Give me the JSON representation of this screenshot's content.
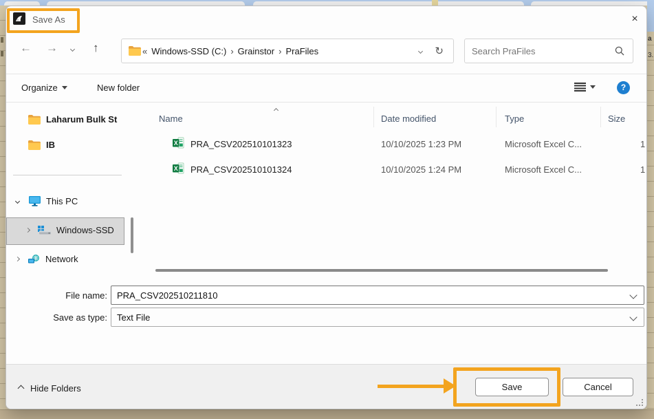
{
  "window": {
    "title": "Save As"
  },
  "glyphs": {
    "back": "←",
    "forward": "→",
    "up": "↑",
    "refresh": "↻",
    "close": "×",
    "help": "?"
  },
  "nav": {
    "breadcrumb_overflow": "«",
    "breadcrumb_separator": "›",
    "crumbs": [
      "Windows-SSD (C:)",
      "Grainstor",
      "PraFiles"
    ],
    "search_placeholder": "Search PraFiles"
  },
  "toolbar": {
    "organize_label": "Organize",
    "new_folder_label": "New folder"
  },
  "sidebar": {
    "items": [
      {
        "label": "Laharum Bulk St"
      },
      {
        "label": "IB"
      },
      {
        "label": "This PC"
      },
      {
        "label": "Windows-SSD"
      },
      {
        "label": "Network"
      }
    ]
  },
  "filelist": {
    "columns": {
      "name": "Name",
      "date": "Date modified",
      "type": "Type",
      "size": "Size"
    },
    "rows": [
      {
        "name": "PRA_CSV202510101323",
        "date": "10/10/2025 1:23 PM",
        "type": "Microsoft Excel C...",
        "size": "1"
      },
      {
        "name": "PRA_CSV202510101324",
        "date": "10/10/2025 1:24 PM",
        "type": "Microsoft Excel C...",
        "size": "1"
      }
    ]
  },
  "fields": {
    "file_name_label": "File name:",
    "file_name_value": "PRA_CSV202510211810",
    "save_type_label": "Save as type:",
    "save_type_value": "Text File"
  },
  "footer": {
    "hide_folders_label": "Hide Folders",
    "save_label": "Save",
    "cancel_label": "Cancel"
  },
  "background": {
    "fragment_top": "a",
    "fragment_bottom": "3."
  },
  "colors": {
    "annotation_orange": "#f3a41f",
    "excel_green": "#107C41",
    "folder_yellow": "#FFC94F",
    "help_blue": "#1e7fd0",
    "selection_gray": "#d9d9d9",
    "desktop_tan": "#d5c9ab",
    "desktop_blue": "#b4cdec"
  }
}
